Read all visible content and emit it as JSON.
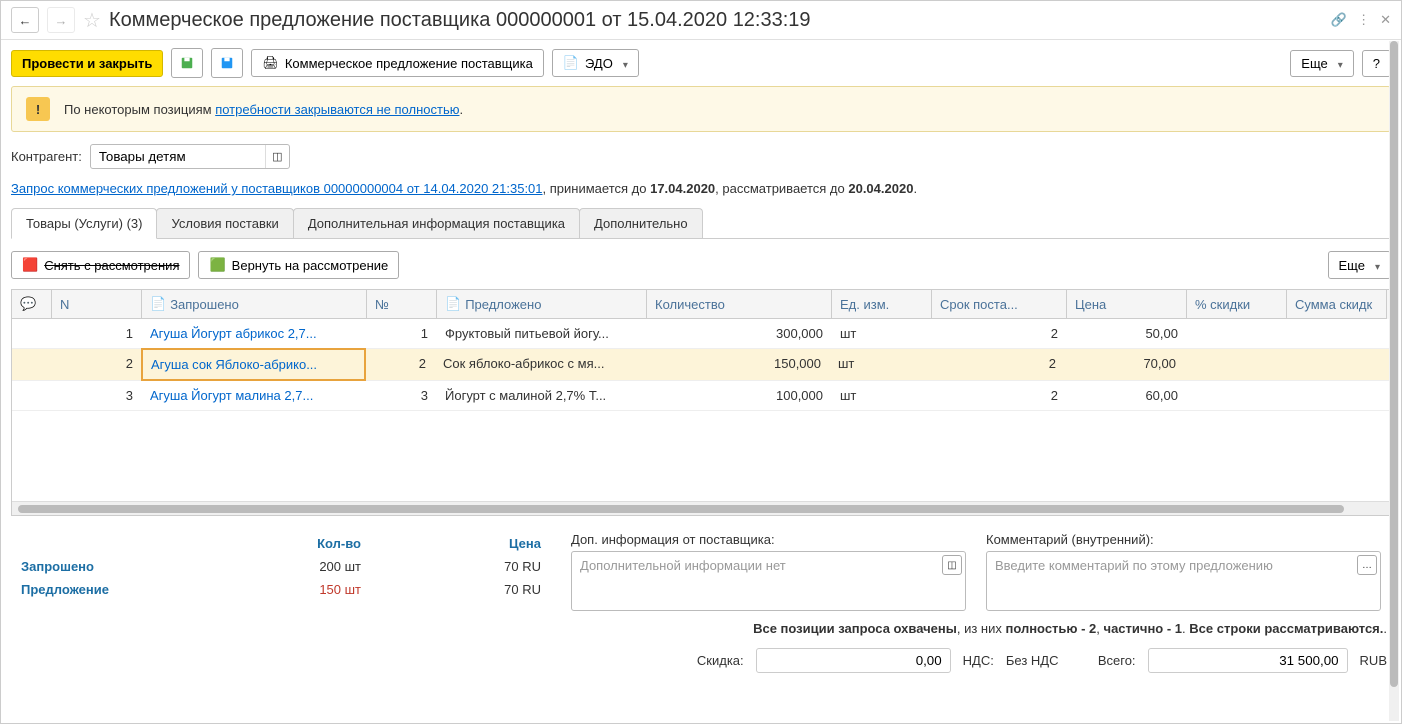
{
  "title": "Коммерческое предложение поставщика 000000001 от 15.04.2020 12:33:19",
  "toolbar": {
    "post_close": "Провести и закрыть",
    "print_label": "Коммерческое предложение поставщика",
    "edo": "ЭДО",
    "more": "Еще",
    "help": "?"
  },
  "warning": {
    "prefix": "По некоторым позициям ",
    "link": "потребности закрываются не полностью",
    "suffix": "."
  },
  "contragent": {
    "label": "Контрагент:",
    "value": "Товары детям"
  },
  "request_line": {
    "link": "Запрос коммерческих предложений у поставщиков 00000000004 от 14.04.2020 21:35:01",
    "mid1": ", принимается до ",
    "date1": "17.04.2020",
    "mid2": ", рассматривается до ",
    "date2": "20.04.2020",
    "end": "."
  },
  "tabs": {
    "t1": "Товары (Услуги) (3)",
    "t2": "Условия поставки",
    "t3": "Дополнительная информация поставщика",
    "t4": "Дополнительно"
  },
  "table_toolbar": {
    "remove": "Снять с рассмотрения",
    "restore": "Вернуть на рассмотрение",
    "more": "Еще"
  },
  "columns": {
    "n": "N",
    "req": "Запрошено",
    "num": "№",
    "prop": "Предложено",
    "qty": "Количество",
    "unit": "Ед. изм.",
    "term": "Срок поста...",
    "price": "Цена",
    "disc": "% скидки",
    "dsum": "Сумма скидк"
  },
  "rows": [
    {
      "n": "1",
      "req": "Агуша Йогурт абрикос 2,7...",
      "num": "1",
      "prop": "Фруктовый питьевой йогу...",
      "qty": "300,000",
      "unit": "шт",
      "term": "2",
      "price": "50,00"
    },
    {
      "n": "2",
      "req": "Агуша сок Яблоко-абрико...",
      "num": "2",
      "prop": "Сок яблоко-абрикос с мя...",
      "qty": "150,000",
      "unit": "шт",
      "term": "2",
      "price": "70,00"
    },
    {
      "n": "3",
      "req": "Агуша Йогурт малина 2,7...",
      "num": "3",
      "prop": "Йогурт с малиной 2,7% Т...",
      "qty": "100,000",
      "unit": "шт",
      "term": "2",
      "price": "60,00"
    }
  ],
  "summary": {
    "col_qty": "Кол-во",
    "col_price": "Цена",
    "req_label": "Запрошено",
    "req_qty": "200 шт",
    "req_price": "70 RU",
    "prop_label": "Предложение",
    "prop_qty": "150 шт",
    "prop_price": "70 RU"
  },
  "side": {
    "supplier_info_label": "Доп. информация от поставщика:",
    "supplier_info_placeholder": "Дополнительной информации нет",
    "comment_label": "Комментарий (внутренний):",
    "comment_placeholder": "Введите комментарий по этому предложению"
  },
  "footer": {
    "line1_a": "Все позиции запроса охвачены",
    "line1_b": ", из них ",
    "line1_c": "полностью - 2",
    "line1_d": ", ",
    "line1_e": "частично - 1",
    "line1_f": ". ",
    "line1_g": "Все строки рассматриваются.",
    "discount_label": "Скидка:",
    "discount_value": "0,00",
    "vat_label": "НДС:",
    "vat_value": "Без НДС",
    "total_label": "Всего:",
    "total_value": "31 500,00",
    "currency": "RUB"
  }
}
